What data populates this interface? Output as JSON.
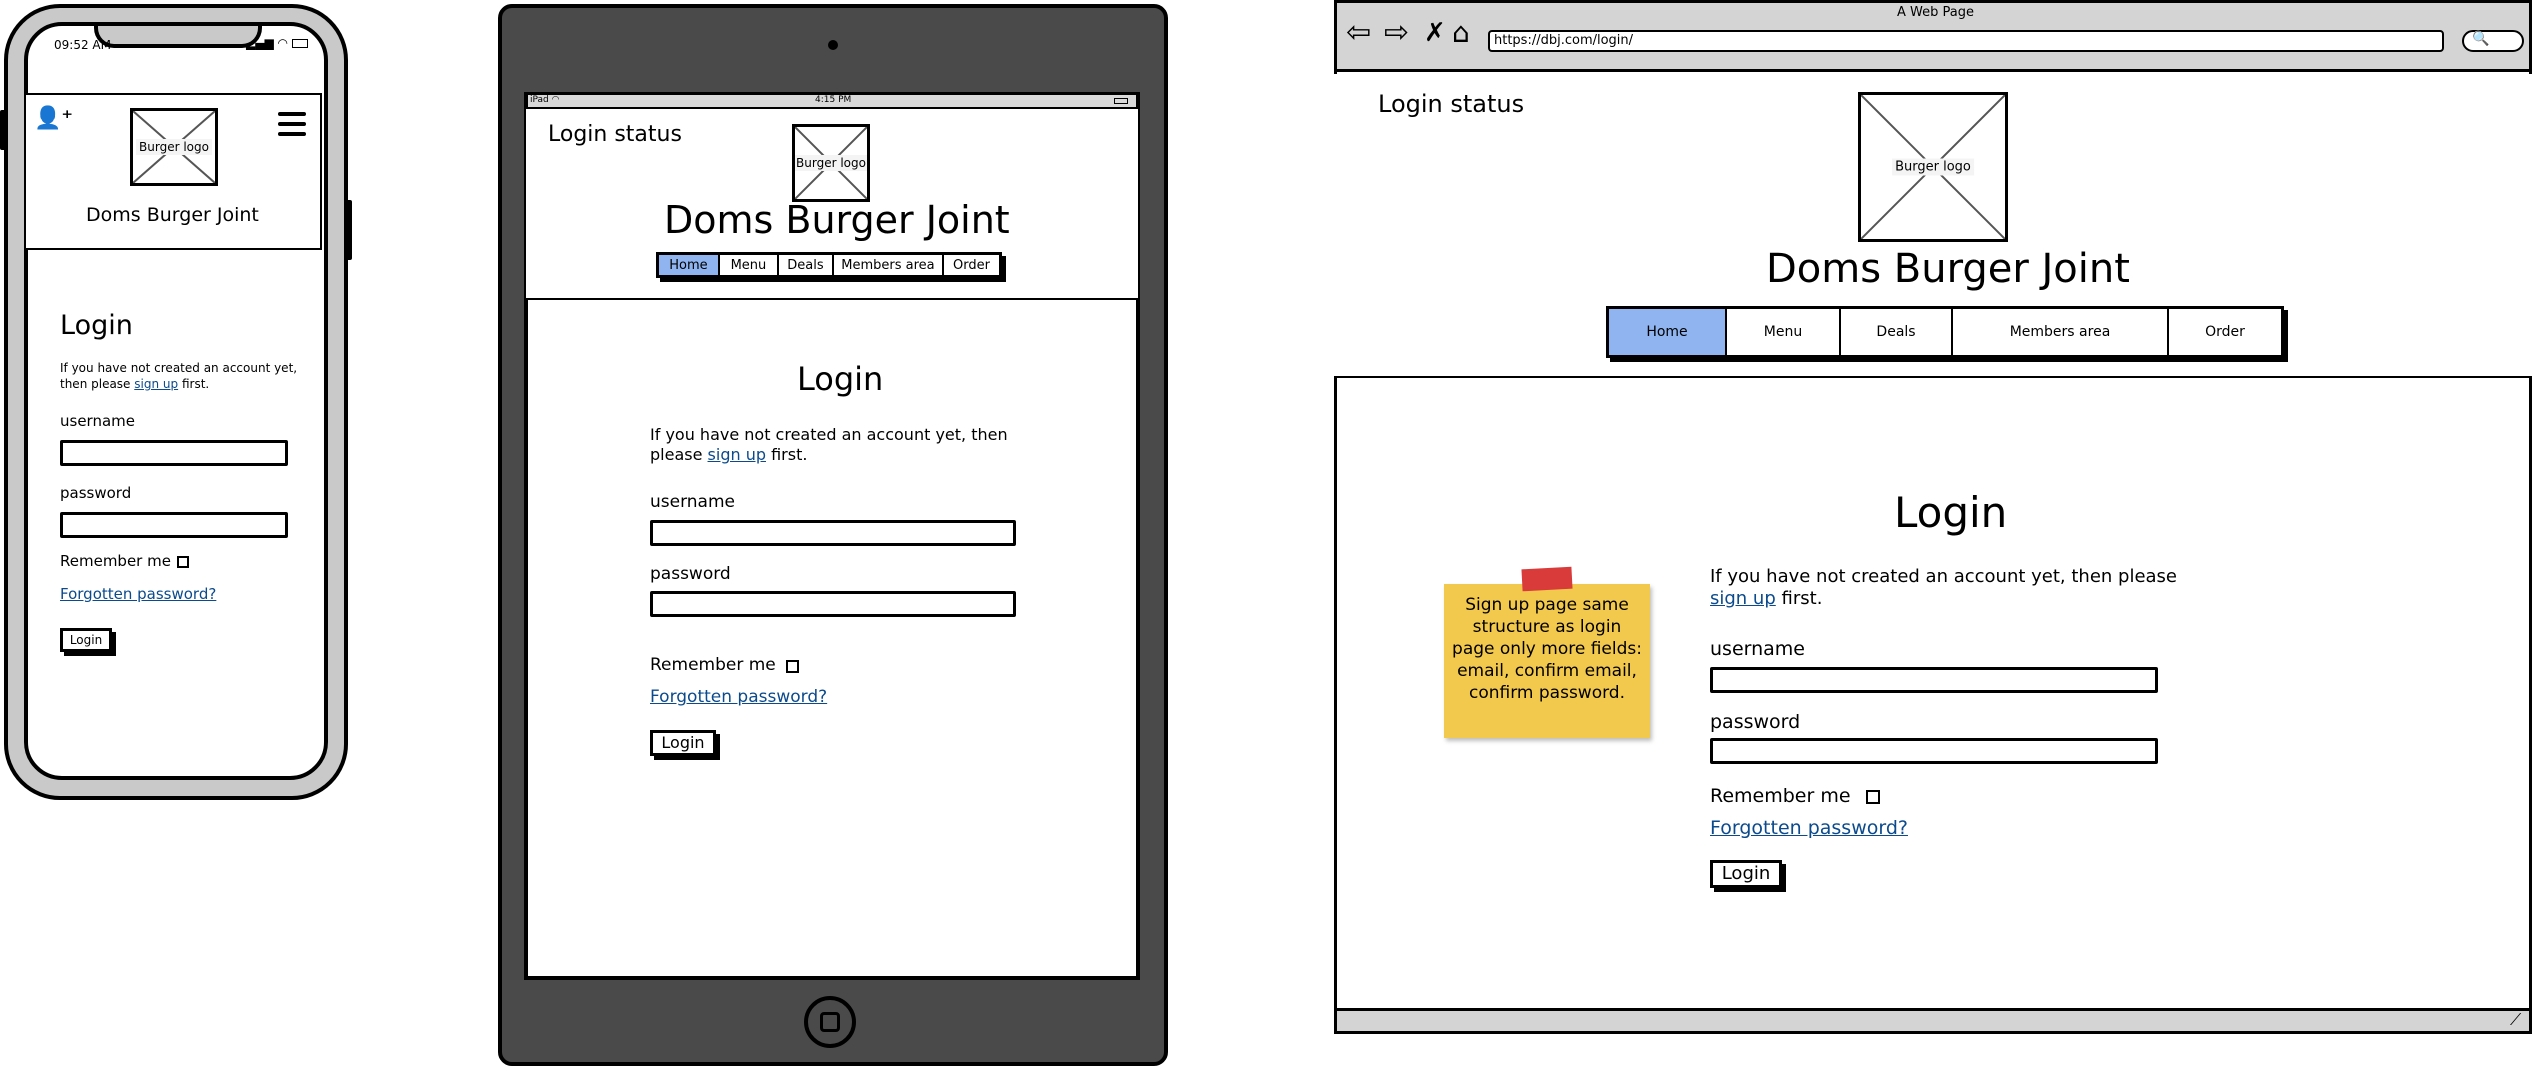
{
  "shared": {
    "logo_caption": "Burger logo",
    "site_title": "Doms Burger Joint",
    "login_heading": "Login",
    "intro_text": "If you have not created an account yet, then please",
    "intro_text_line1": "If you have not created an account yet,",
    "intro_text_line2": "then please",
    "intro_text_tab1": "If you have not created an account yet, then",
    "intro_text_tab2": "please",
    "sign_up_link": "sign up",
    "first_word": "first.",
    "username_label": "username",
    "password_label": "password",
    "remember_label": "Remember me",
    "forgot_link": "Forgotten password?",
    "login_button": "Login",
    "login_status": "Login status"
  },
  "nav": [
    "Home",
    "Menu",
    "Deals",
    "Members area",
    "Order"
  ],
  "phone": {
    "time": "09:52 AM"
  },
  "tablet": {
    "carrier": "iPad",
    "time": "4:15 PM"
  },
  "browser": {
    "window_title": "A Web Page",
    "url": "https://dbj.com/login/",
    "sticky_note": [
      "Sign up page same",
      "structure as login",
      "page only more fields:",
      "email, confirm email,",
      "confirm password."
    ]
  }
}
